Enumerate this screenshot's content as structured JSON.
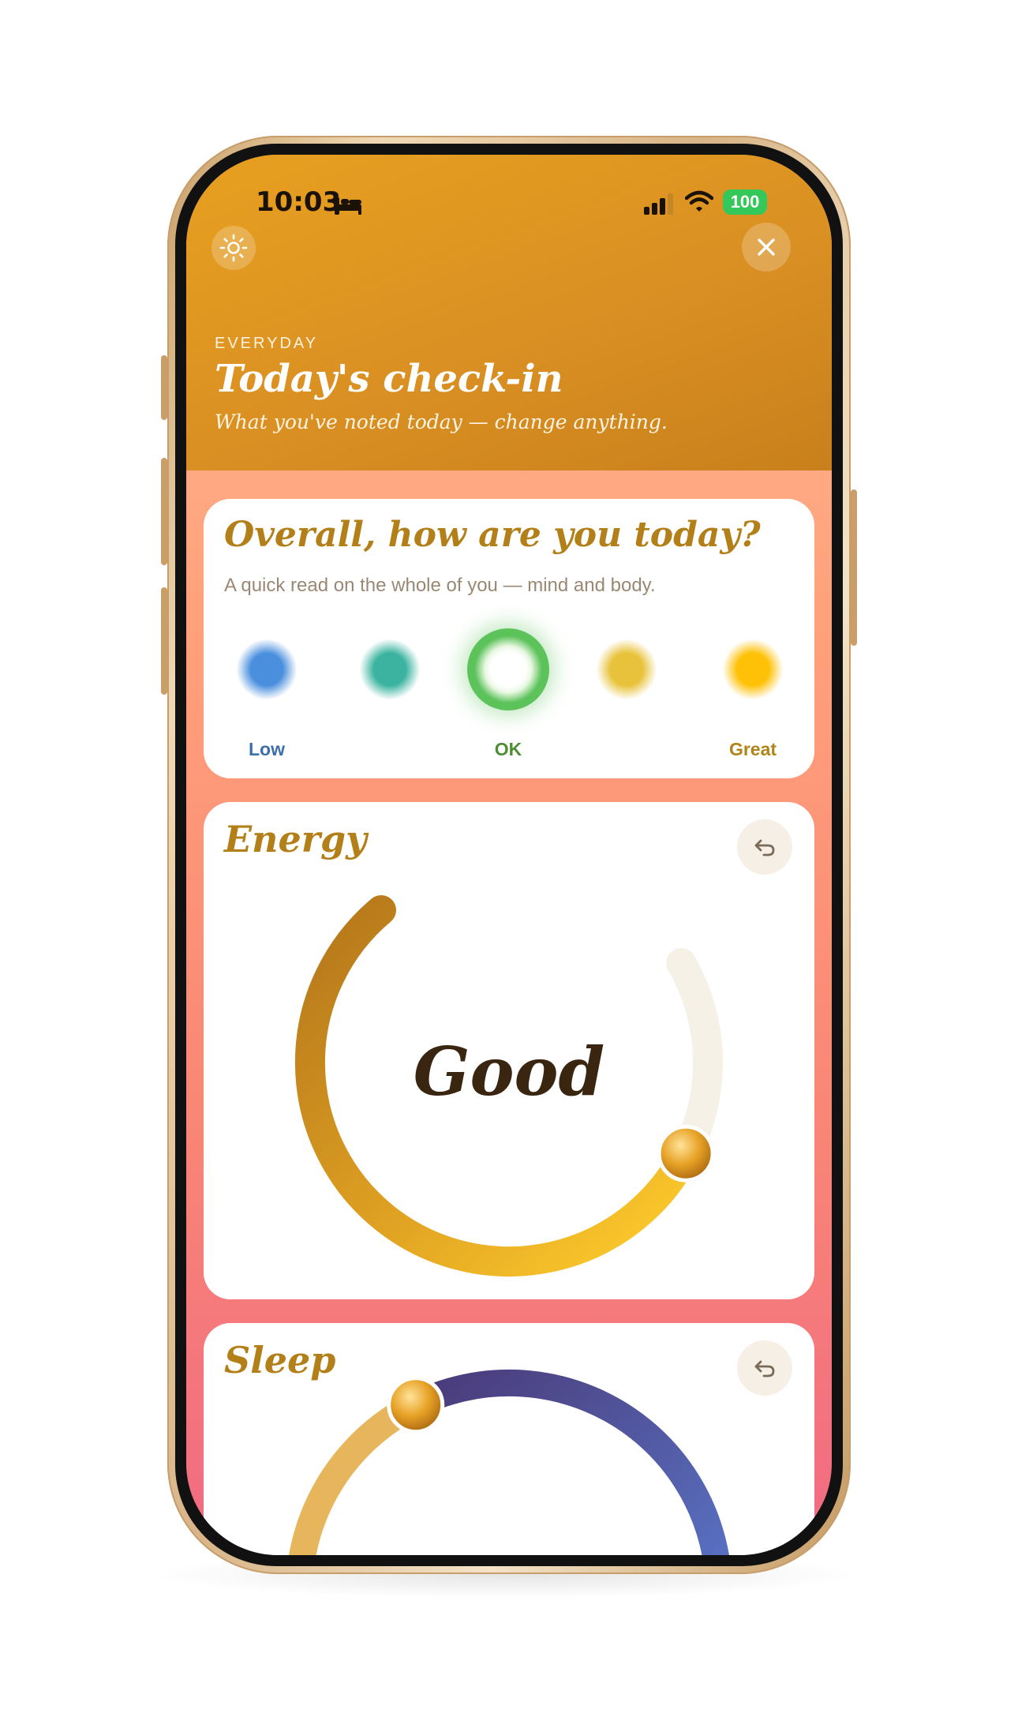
{
  "status_bar": {
    "time": "10:03",
    "battery": "100",
    "icons": [
      "bed-icon",
      "cellular-signal-icon",
      "wifi-icon",
      "battery-icon"
    ]
  },
  "header": {
    "settings_icon": "sun-icon",
    "close_icon": "close-icon",
    "eyebrow": "EVERYDAY",
    "title": "Today's check-in",
    "subtitle": "What you've noted today — change anything."
  },
  "overall": {
    "title": "Overall, how are you today?",
    "subtitle": "A quick read on the whole of you — mind and body.",
    "options": [
      {
        "id": "low",
        "label": "Low",
        "color": "#4a8fdd",
        "selected": false
      },
      {
        "id": "meh",
        "label": "",
        "color": "#3bb3a0",
        "selected": false
      },
      {
        "id": "ok",
        "label": "OK",
        "color": "#5cc25a",
        "selected": true
      },
      {
        "id": "good",
        "label": "",
        "color": "#e8c23a",
        "selected": false
      },
      {
        "id": "great",
        "label": "Great",
        "color": "#ffc107",
        "selected": false
      }
    ],
    "label_colors": {
      "low": "#3d6fa8",
      "ok": "#4e8d36",
      "great": "#b08418"
    }
  },
  "energy": {
    "title": "Energy",
    "value_label": "Good",
    "undo_icon": "undo-icon",
    "level": 0.78
  },
  "sleep": {
    "title": "Sleep",
    "undo_icon": "undo-icon",
    "level": 0.38
  },
  "colors": {
    "accent": "#b27f18",
    "header": "#da9022",
    "dial_start": "#b4761a",
    "dial_end": "#ffcf2d",
    "track": "#f6f1e7"
  }
}
